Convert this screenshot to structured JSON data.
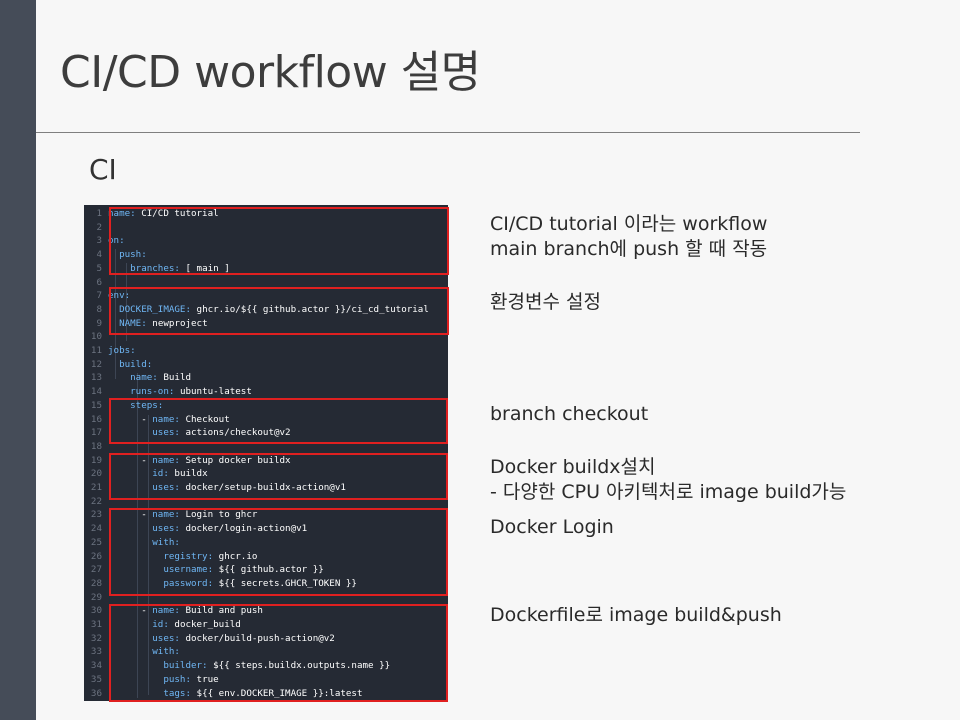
{
  "slide": {
    "title": "CI/CD workflow 설명",
    "section": "CI"
  },
  "code": {
    "lines": [
      {
        "n": "1",
        "indent": "",
        "key": "name:",
        "val": " CI/CD tutorial"
      },
      {
        "n": "2",
        "indent": "",
        "key": "",
        "val": ""
      },
      {
        "n": "3",
        "indent": "",
        "key": "on:",
        "val": ""
      },
      {
        "n": "4",
        "indent": "  ",
        "key": "push:",
        "val": ""
      },
      {
        "n": "5",
        "indent": "    ",
        "key": "branches:",
        "val": " [ main ]"
      },
      {
        "n": "6",
        "indent": "",
        "key": "",
        "val": ""
      },
      {
        "n": "7",
        "indent": "",
        "key": "env:",
        "val": ""
      },
      {
        "n": "8",
        "indent": "  ",
        "key": "DOCKER_IMAGE:",
        "val": " ghcr.io/${{ github.actor }}/ci_cd_tutorial"
      },
      {
        "n": "9",
        "indent": "  ",
        "key": "NAME:",
        "val": " newproject"
      },
      {
        "n": "10",
        "indent": "",
        "key": "",
        "val": ""
      },
      {
        "n": "11",
        "indent": "",
        "key": "jobs:",
        "val": ""
      },
      {
        "n": "12",
        "indent": "  ",
        "key": "build:",
        "val": ""
      },
      {
        "n": "13",
        "indent": "    ",
        "key": "name:",
        "val": " Build"
      },
      {
        "n": "14",
        "indent": "    ",
        "key": "runs-on:",
        "val": " ubuntu-latest"
      },
      {
        "n": "15",
        "indent": "    ",
        "key": "steps:",
        "val": ""
      },
      {
        "n": "16",
        "indent": "      - ",
        "key": "name:",
        "val": " Checkout"
      },
      {
        "n": "17",
        "indent": "        ",
        "key": "uses:",
        "val": " actions/checkout@v2"
      },
      {
        "n": "18",
        "indent": "",
        "key": "",
        "val": ""
      },
      {
        "n": "19",
        "indent": "      - ",
        "key": "name:",
        "val": " Setup docker buildx"
      },
      {
        "n": "20",
        "indent": "        ",
        "key": "id:",
        "val": " buildx"
      },
      {
        "n": "21",
        "indent": "        ",
        "key": "uses:",
        "val": " docker/setup-buildx-action@v1"
      },
      {
        "n": "22",
        "indent": "",
        "key": "",
        "val": ""
      },
      {
        "n": "23",
        "indent": "      - ",
        "key": "name:",
        "val": " Login to ghcr"
      },
      {
        "n": "24",
        "indent": "        ",
        "key": "uses:",
        "val": " docker/login-action@v1"
      },
      {
        "n": "25",
        "indent": "        ",
        "key": "with:",
        "val": ""
      },
      {
        "n": "26",
        "indent": "          ",
        "key": "registry:",
        "val": " ghcr.io"
      },
      {
        "n": "27",
        "indent": "          ",
        "key": "username:",
        "val": " ${{ github.actor }}"
      },
      {
        "n": "28",
        "indent": "          ",
        "key": "password:",
        "val": " ${{ secrets.GHCR_TOKEN }}"
      },
      {
        "n": "29",
        "indent": "",
        "key": "",
        "val": ""
      },
      {
        "n": "30",
        "indent": "      - ",
        "key": "name:",
        "val": " Build and push"
      },
      {
        "n": "31",
        "indent": "        ",
        "key": "id:",
        "val": " docker_build"
      },
      {
        "n": "32",
        "indent": "        ",
        "key": "uses:",
        "val": " docker/build-push-action@v2"
      },
      {
        "n": "33",
        "indent": "        ",
        "key": "with:",
        "val": ""
      },
      {
        "n": "34",
        "indent": "          ",
        "key": "builder:",
        "val": " ${{ steps.buildx.outputs.name }}"
      },
      {
        "n": "35",
        "indent": "          ",
        "key": "push:",
        "val": " true"
      },
      {
        "n": "36",
        "indent": "          ",
        "key": "tags:",
        "val": " ${{ env.DOCKER_IMAGE }}:latest"
      }
    ]
  },
  "annotations": {
    "workflow_name": "CI/CD tutorial 이라는 workflow",
    "trigger": "main branch에 push 할 때 작동",
    "env": "환경변수 설정",
    "checkout": "branch checkout",
    "buildx": "Docker buildx설치",
    "buildx_detail": " - 다양한 CPU 아키텍처로 image build가능",
    "login": "Docker Login",
    "build_push": "Dockerfile로  image build&push"
  },
  "colors": {
    "code_bg": "#252a34",
    "code_key": "#6fb6f4",
    "highlight_border": "#e02020",
    "side_bar": "#454c58"
  }
}
